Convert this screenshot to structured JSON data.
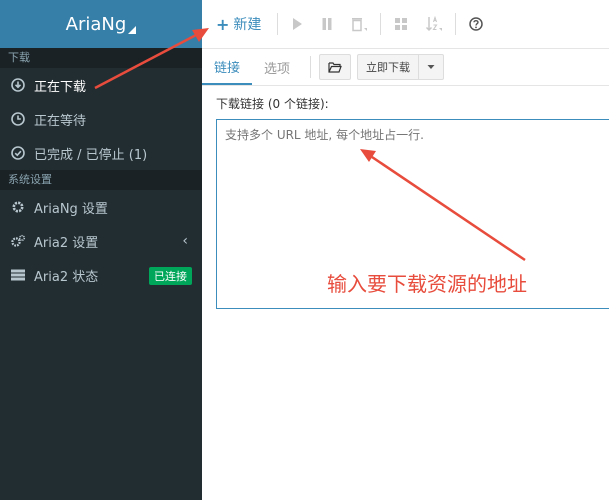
{
  "app": {
    "brand": "AriaNg"
  },
  "sidebar": {
    "sections": [
      {
        "title": "下载"
      },
      {
        "title": "系统设置"
      }
    ],
    "downloads": [
      {
        "label": "正在下载",
        "icon": "download-circle-icon"
      },
      {
        "label": "正在等待",
        "icon": "clock-icon"
      },
      {
        "label": "已完成 / 已停止 (1)",
        "icon": "check-circle-icon"
      }
    ],
    "settings": [
      {
        "label": "AriaNg 设置",
        "icon": "gear-icon"
      },
      {
        "label": "Aria2 设置",
        "icon": "gears-icon",
        "chevron": "‹"
      },
      {
        "label": "Aria2 状态",
        "icon": "server-icon",
        "badge": "已连接"
      }
    ]
  },
  "header": {
    "new_label": "新建",
    "new_icon": "plus-icon"
  },
  "tabs": [
    {
      "label": "链接"
    },
    {
      "label": "选项"
    }
  ],
  "toolbar": {
    "download_now": "立即下载"
  },
  "form": {
    "label": "下载链接 (0 个链接):",
    "placeholder": "支持多个 URL 地址, 每个地址占一行."
  },
  "annotation": {
    "text": "输入要下载资源的地址",
    "color": "#e74c3c"
  },
  "colors": {
    "sidebar_bg": "#222d32",
    "brand_bg": "#367fa9",
    "accent": "#3c8dbc",
    "badge_green": "#00a65a"
  }
}
